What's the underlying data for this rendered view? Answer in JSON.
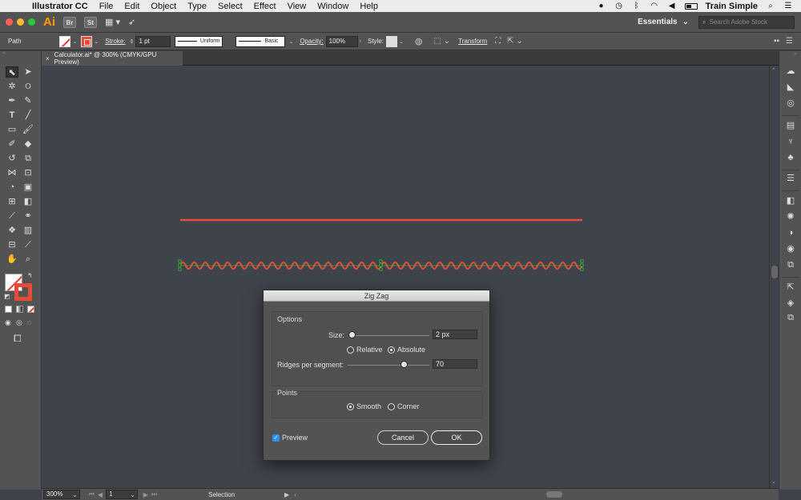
{
  "menubar": {
    "apple": "",
    "app_name": "Illustrator CC",
    "items": [
      "File",
      "Edit",
      "Object",
      "Type",
      "Select",
      "Effect",
      "View",
      "Window",
      "Help"
    ],
    "user": "Train Simple"
  },
  "appbar": {
    "logo": "Ai",
    "badge_br": "Br",
    "badge_st": "St",
    "workspace": "Essentials",
    "search_placeholder": "Search Adobe Stock"
  },
  "control": {
    "object_type": "Path",
    "stroke_label": "Stroke:",
    "stroke_weight": "1 pt",
    "profile": "Uniform",
    "brush": "Basic",
    "opacity_label": "Opacity:",
    "opacity": "100%",
    "style_label": "Style:",
    "transform": "Transform"
  },
  "document": {
    "tab_title": "Calculator.ai* @ 300% (CMYK/GPU Preview)",
    "close": "×"
  },
  "status": {
    "zoom": "300%",
    "artboard": "1",
    "tool": "Selection"
  },
  "artwork": {
    "stroke_color": "#e84b3a",
    "anchor_color": "#3ddc3d"
  },
  "dialog": {
    "title": "Zig Zag",
    "options_title": "Options",
    "size_label": "Size:",
    "size_value": "2 px",
    "size_fraction": 0.02,
    "relative_label": "Relative",
    "absolute_label": "Absolute",
    "ridges_label": "Ridges per segment:",
    "ridges_value": "70",
    "ridges_fraction": 0.7,
    "points_title": "Points",
    "smooth_label": "Smooth",
    "corner_label": "Corner",
    "preview_label": "Preview",
    "cancel_label": "Cancel",
    "ok_label": "OK"
  },
  "colors": {
    "canvas": "#3f434b",
    "chrome": "#535353",
    "accent": "#2f8ff0"
  }
}
